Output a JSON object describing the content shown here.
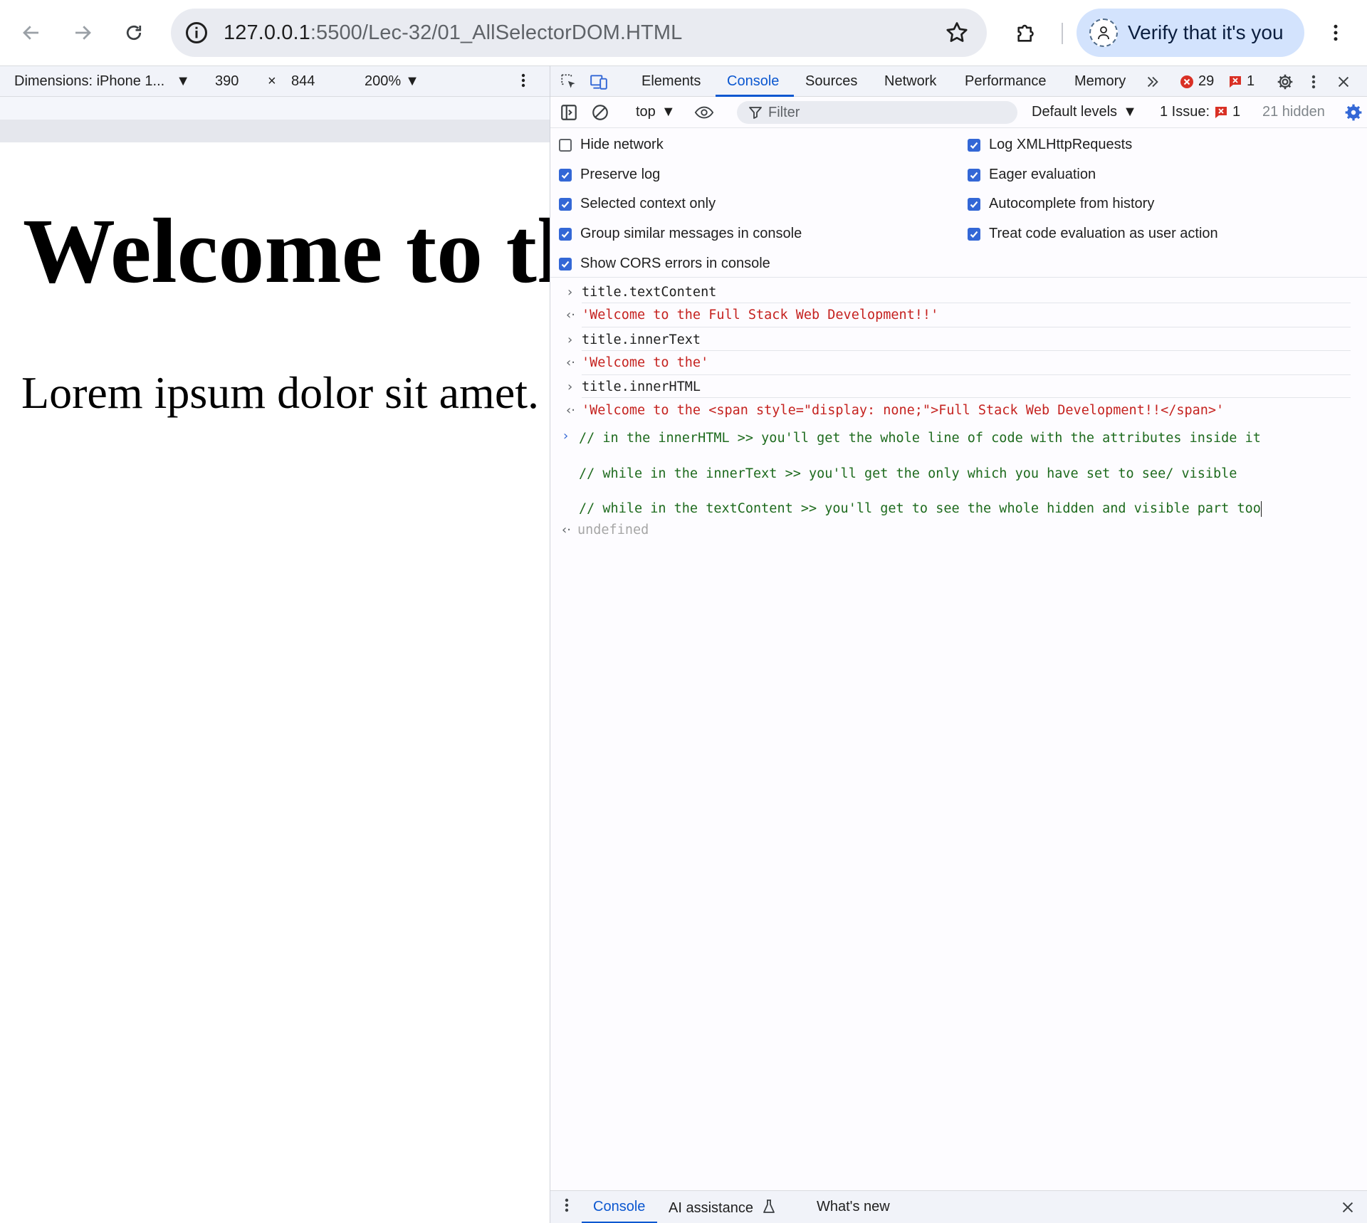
{
  "browser": {
    "url_host": "127.0.0.1",
    "url_path": ":5500/Lec-32/01_AllSelectorDOM.HTML",
    "verify_label": "Verify that it's you"
  },
  "device_toolbar": {
    "dimensions_label": "Dimensions: iPhone 1...",
    "width": "390",
    "times": "×",
    "height": "844",
    "zoom": "200%"
  },
  "page": {
    "heading": "Welcome to the",
    "paragraph": "Lorem ipsum dolor sit amet."
  },
  "devtools": {
    "tabs": [
      "Elements",
      "Console",
      "Sources",
      "Network",
      "Performance",
      "Memory"
    ],
    "error_count": "29",
    "issue_count": "1",
    "console_bar": {
      "context": "top",
      "filter_placeholder": "Filter",
      "levels": "Default levels",
      "issues_label": "1 Issue:",
      "issues_count": "1",
      "hidden": "21 hidden"
    },
    "settings": {
      "left": [
        {
          "label": "Hide network",
          "checked": false
        },
        {
          "label": "Preserve log",
          "checked": true
        },
        {
          "label": "Selected context only",
          "checked": true
        },
        {
          "label": "Group similar messages in console",
          "checked": true
        },
        {
          "label": "Show CORS errors in console",
          "checked": true
        }
      ],
      "right": [
        {
          "label": "Log XMLHttpRequests",
          "checked": true
        },
        {
          "label": "Eager evaluation",
          "checked": true
        },
        {
          "label": "Autocomplete from history",
          "checked": true
        },
        {
          "label": "Treat code evaluation as user action",
          "checked": true
        }
      ]
    },
    "console_log": [
      {
        "kind": "in",
        "text": "title.textContent"
      },
      {
        "kind": "out",
        "text": "'Welcome to the Full Stack Web Development!!'"
      },
      {
        "kind": "in",
        "text": "title.innerText"
      },
      {
        "kind": "out",
        "text": "'Welcome to the'"
      },
      {
        "kind": "in",
        "text": "title.innerHTML"
      },
      {
        "kind": "out",
        "text": "'Welcome to the <span style=\"display: none;\">Full Stack Web Development!!</span>'"
      },
      {
        "kind": "comment",
        "text": "// in the innerHTML >> you'll get the whole line of code with the attributes inside it"
      },
      {
        "kind": "comment",
        "text": "// while in the innerText >> you'll get the only which you have set to see/ visible"
      },
      {
        "kind": "comment",
        "text": "// while in the textContent >> you'll get to see the whole hidden and visible part too"
      },
      {
        "kind": "result",
        "text": "undefined"
      }
    ],
    "drawer_tabs": [
      "Console",
      "AI assistance",
      "What's new"
    ]
  }
}
